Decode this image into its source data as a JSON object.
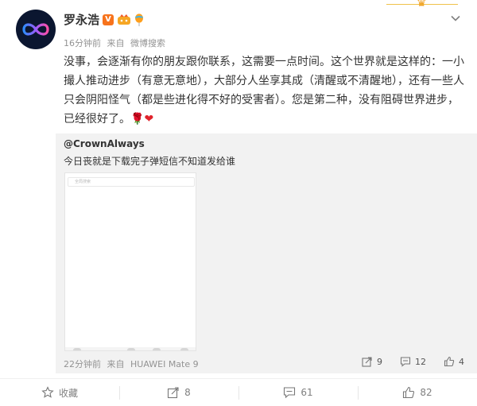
{
  "post": {
    "author": "罗永浩",
    "verified_badge": "V",
    "time": "16分钟前",
    "from_prefix": "来自",
    "source": "微博搜索",
    "content": "没事，会逐渐有你的朋友跟你联系，这需要一点时间。这个世界就是这样的：一小撮人推动进步（有意无意地），大部分人坐享其成（清醒或不清醒地），还有一些人只会阴阳怪气（都是些进化得不好的受害者）。您是第二种，没有阻碍世界进步，已经很好了。",
    "emoji_rose": "🌹",
    "emoji_heart": "❤"
  },
  "repost": {
    "user": "@CrownAlways",
    "text": "今日丧就是下载完子弹短信不知道发给谁",
    "thumb_search_placeholder": "全局搜索",
    "time": "22分钟前",
    "from_prefix": "来自",
    "source": "HUAWEI Mate 9",
    "forward_count": "9",
    "comment_count": "12",
    "like_count": "4"
  },
  "footer": {
    "favorite_label": "收藏",
    "forward_count": "8",
    "comment_count": "61",
    "like_count": "82"
  },
  "colors": {
    "accent_orange": "#f7731c",
    "repost_bg": "#f2f2f2",
    "meta_gray": "#939393"
  },
  "icons": [
    "avatar-infinity-icon",
    "verified-icon",
    "member-icon",
    "balloon-icon",
    "chevron-down-icon",
    "forward-icon",
    "comment-icon",
    "like-icon",
    "star-icon"
  ]
}
